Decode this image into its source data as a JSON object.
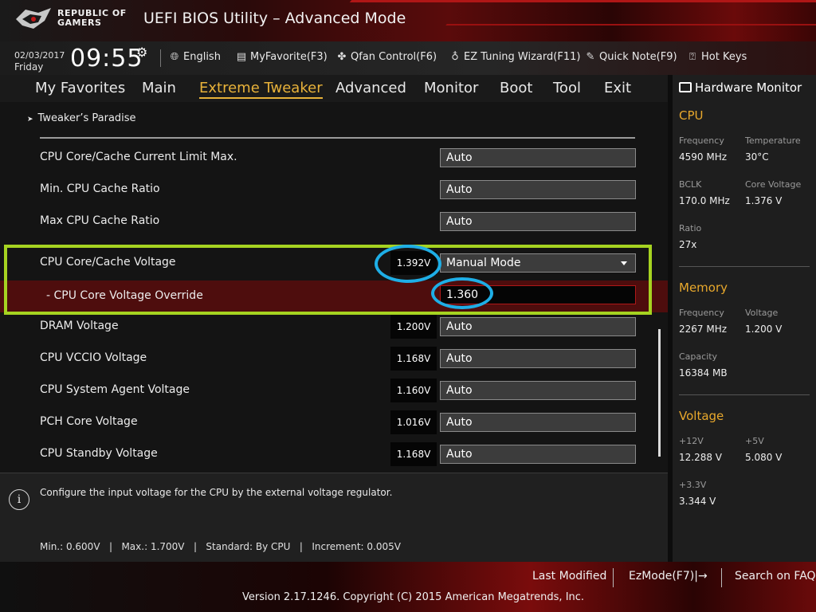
{
  "header": {
    "brand_line1": "REPUBLIC OF",
    "brand_line2": "GAMERS",
    "title": "UEFI BIOS Utility – Advanced Mode",
    "logo_icon": "rog-eye-logo"
  },
  "toolbar": {
    "date": "02/03/2017",
    "day": "Friday",
    "time": "09:55",
    "items": [
      {
        "label": "English",
        "icon": "globe-icon"
      },
      {
        "label": "MyFavorite(F3)",
        "icon": "favorite-icon"
      },
      {
        "label": "Qfan Control(F6)",
        "icon": "fan-icon"
      },
      {
        "label": "EZ Tuning Wizard(F11)",
        "icon": "bulb-icon"
      },
      {
        "label": "Quick Note(F9)",
        "icon": "note-icon"
      },
      {
        "label": "Hot Keys",
        "icon": "hotkeys-icon"
      }
    ]
  },
  "tabs": [
    "My Favorites",
    "Main",
    "Extreme Tweaker",
    "Advanced",
    "Monitor",
    "Boot",
    "Tool",
    "Exit"
  ],
  "active_tab": "Extreme Tweaker",
  "breadcrumb": "Tweaker’s Paradise",
  "settings": [
    {
      "label": "CPU Core/Cache Current Limit Max.",
      "value": "Auto"
    },
    {
      "label": "Min. CPU Cache Ratio",
      "value": "Auto"
    },
    {
      "label": "Max CPU Cache Ratio",
      "value": "Auto"
    },
    {
      "label": "CPU Core/Cache Voltage",
      "reading": "1.392V",
      "value": "Manual Mode",
      "dropdown": true
    },
    {
      "label": "- CPU Core Voltage Override",
      "value": "1.360",
      "selected": true
    },
    {
      "label": "DRAM Voltage",
      "reading": "1.200V",
      "value": "Auto"
    },
    {
      "label": "CPU VCCIO Voltage",
      "reading": "1.168V",
      "value": "Auto"
    },
    {
      "label": "CPU System Agent Voltage",
      "reading": "1.160V",
      "value": "Auto"
    },
    {
      "label": "PCH Core Voltage",
      "reading": "1.016V",
      "value": "Auto"
    },
    {
      "label": "CPU Standby Voltage",
      "reading": "1.168V",
      "value": "Auto"
    }
  ],
  "help": {
    "icon": "info-icon",
    "text": "Configure the input voltage for the CPU by the external voltage regulator.",
    "range": "Min.: 0.600V   |   Max.: 1.700V   |   Standard: By CPU   |   Increment: 0.005V"
  },
  "hardware_monitor": {
    "title": "Hardware Monitor",
    "cpu": {
      "title": "CPU",
      "frequency_label": "Frequency",
      "frequency": "4590 MHz",
      "temperature_label": "Temperature",
      "temperature": "30°C",
      "bclk_label": "BCLK",
      "bclk": "170.0 MHz",
      "core_voltage_label": "Core Voltage",
      "core_voltage": "1.376 V",
      "ratio_label": "Ratio",
      "ratio": "27x"
    },
    "memory": {
      "title": "Memory",
      "frequency_label": "Frequency",
      "frequency": "2267 MHz",
      "voltage_label": "Voltage",
      "voltage": "1.200 V",
      "capacity_label": "Capacity",
      "capacity": "16384 MB"
    },
    "voltage": {
      "title": "Voltage",
      "v12_label": "+12V",
      "v12": "12.288 V",
      "v5_label": "+5V",
      "v5": "5.080 V",
      "v33_label": "+3.3V",
      "v33": "3.344 V"
    }
  },
  "footer": {
    "last_modified": "Last Modified",
    "ezmode": "EzMode(F7)|→",
    "search_faq": "Search on FAQ",
    "copyright": "Version 2.17.1246. Copyright (C) 2015 American Megatrends, Inc."
  },
  "colors": {
    "accent": "#e8b23a",
    "selected_row": "#4e0d0d",
    "highlight_annotation": "#a6d321",
    "circle_annotation": "#1eaee6"
  }
}
